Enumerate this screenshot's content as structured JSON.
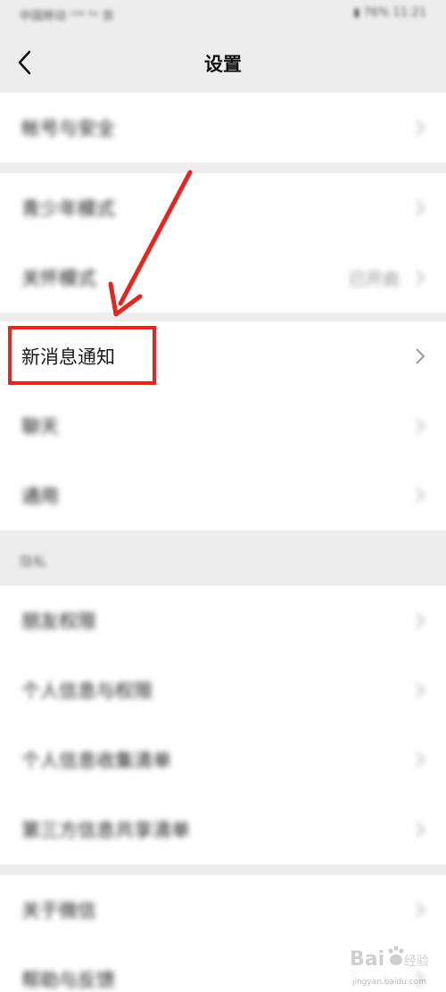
{
  "status_bar": {
    "left": "中国移动 ᵛ⁵ᴳ ˡᵗᵉ 奈",
    "right": "▮ 76% 11:21"
  },
  "nav": {
    "title": "设置"
  },
  "groups": [
    {
      "rows": [
        {
          "label": "帐号与安全",
          "value": ""
        }
      ]
    },
    {
      "rows": [
        {
          "label": "青少年模式",
          "value": ""
        },
        {
          "label": "关怀模式",
          "value": "已开启"
        }
      ]
    },
    {
      "rows": [
        {
          "label": "新消息通知",
          "value": ""
        },
        {
          "label": "聊天",
          "value": ""
        },
        {
          "label": "通用",
          "value": ""
        }
      ]
    },
    {
      "header": "隐私",
      "rows": [
        {
          "label": "朋友权限",
          "value": ""
        },
        {
          "label": "个人信息与权限",
          "value": ""
        },
        {
          "label": "个人信息收集清单",
          "value": ""
        },
        {
          "label": "第三方信息共享清单",
          "value": ""
        }
      ]
    },
    {
      "rows": [
        {
          "label": "关于微信",
          "value": ""
        },
        {
          "label": "帮助与反馈",
          "value": ""
        }
      ]
    }
  ],
  "annotation": {
    "color": "#e8241e"
  },
  "watermark": {
    "brand": "Bai",
    "brand_suffix": "经验",
    "url": "jingyan.baidu.com"
  },
  "icons": {
    "back": "chevron-left-icon",
    "row_arrow": "chevron-right-icon",
    "logo": "baidu-paw-icon"
  }
}
